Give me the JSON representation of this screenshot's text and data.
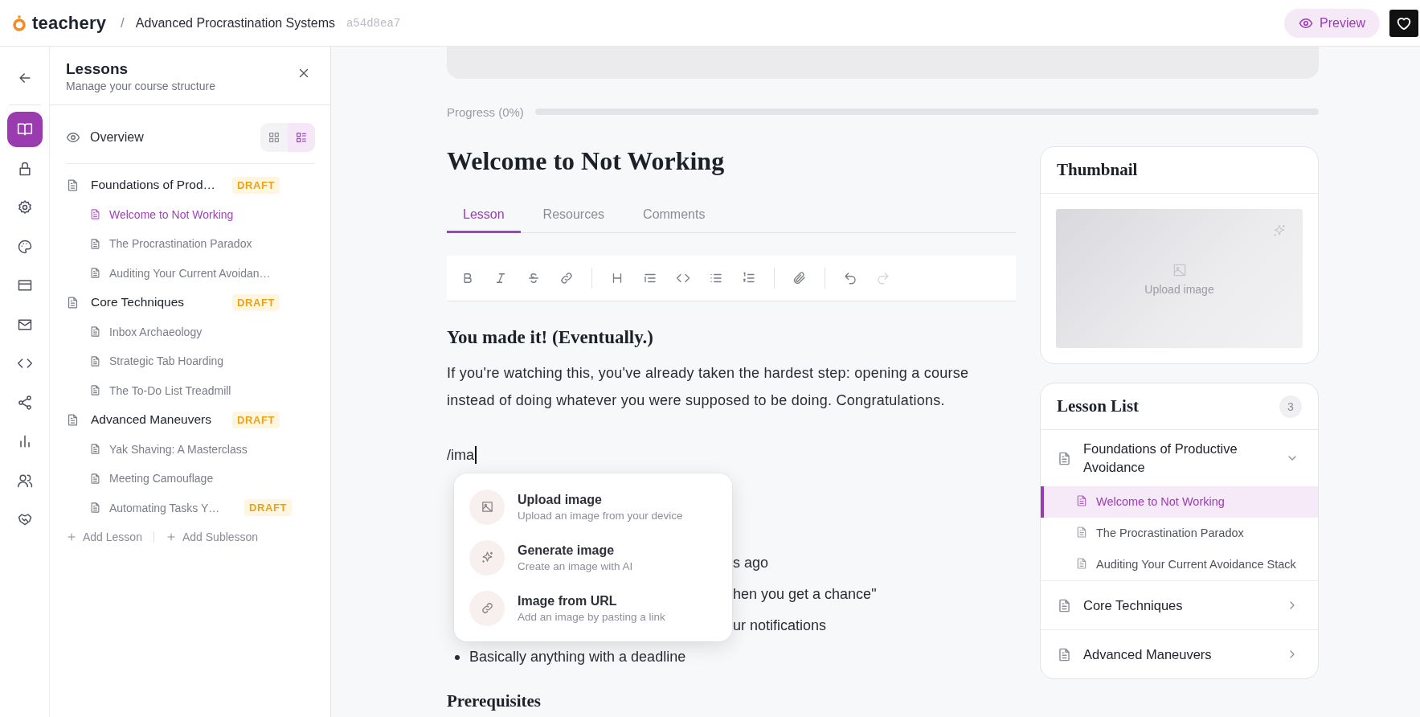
{
  "header": {
    "logo_text": "teachery",
    "separator": "/",
    "course_title": "Advanced Procrastination Systems",
    "course_id": "a54d8ea7",
    "preview_button": "Preview"
  },
  "rail": {
    "items": [
      {
        "selected": true
      },
      {
        "selected": false
      },
      {
        "selected": false
      },
      {
        "selected": false
      },
      {
        "selected": false
      },
      {
        "selected": false
      },
      {
        "selected": false
      },
      {
        "selected": false
      },
      {
        "selected": false
      },
      {
        "selected": false
      },
      {
        "selected": false
      }
    ]
  },
  "lessons_panel": {
    "title": "Lessons",
    "subtitle": "Manage your course structure",
    "overview": "Overview",
    "view_toggle": [
      {
        "selected": false
      },
      {
        "selected": true
      }
    ],
    "tree": [
      {
        "label": "Foundations of Prod…",
        "badge": "DRAFT",
        "selected": false,
        "children": [
          {
            "label": "Welcome to Not Working",
            "selected": true
          },
          {
            "label": "The Procrastination Paradox",
            "selected": false
          },
          {
            "label": "Auditing Your Current Avoidan…",
            "selected": false
          }
        ]
      },
      {
        "label": "Core Techniques",
        "badge": "DRAFT",
        "selected": false,
        "children": [
          {
            "label": "Inbox Archaeology",
            "selected": false
          },
          {
            "label": "Strategic Tab Hoarding",
            "selected": false
          },
          {
            "label": "The To-Do List Treadmill",
            "selected": false
          }
        ]
      },
      {
        "label": "Advanced Maneuvers",
        "badge": "DRAFT",
        "selected": false,
        "children": [
          {
            "label": "Yak Shaving: A Masterclass",
            "selected": false
          },
          {
            "label": "Meeting Camouflage",
            "selected": false
          },
          {
            "label": "Automating Tasks Y…",
            "badge": "DRAFT",
            "selected": false
          }
        ]
      }
    ],
    "add_lesson": "Add Lesson",
    "add_sublesson": "Add Sublesson"
  },
  "editor": {
    "progress_label": "Progress (0%)",
    "progress": {
      "level": 0
    },
    "title": "Welcome to Not Working",
    "tabs": [
      {
        "label": "Lesson",
        "selected": true
      },
      {
        "label": "Resources",
        "selected": false
      },
      {
        "label": "Comments",
        "selected": false
      }
    ],
    "toolbar": [
      [
        {
          "disabled": false
        },
        {
          "disabled": false
        },
        {
          "disabled": false
        },
        {
          "disabled": false
        }
      ],
      [
        {
          "disabled": false
        },
        {
          "disabled": false
        },
        {
          "disabled": false
        },
        {
          "disabled": false
        },
        {
          "disabled": false
        }
      ],
      [
        {
          "disabled": false
        }
      ],
      [
        {
          "disabled": false
        },
        {
          "disabled": true
        }
      ]
    ],
    "heading": "You made it! (Eventually.)",
    "paragraph": "If you're watching this, you've already taken the hardest step: opening a course instead of doing whatever you were supposed to be doing. Congratulations.",
    "slash_command": "/ima",
    "slash_menu": [
      {
        "title": "Upload image",
        "description": "Upload an image from your device"
      },
      {
        "title": "Generate image",
        "description": "Create an image with AI"
      },
      {
        "title": "Image from URL",
        "description": "Add an image by pasting a link"
      }
    ],
    "list": [
      {
        "kind": "covered",
        "text": "s ago"
      },
      {
        "kind": "covered",
        "text": "hen you get a chance\""
      },
      {
        "kind": "covered",
        "text": "ur notifications"
      },
      {
        "kind": "bullet",
        "text": "Basically anything with a deadline"
      }
    ],
    "next_heading": "Prerequisites"
  },
  "thumbnail": {
    "title": "Thumbnail",
    "upload_label": "Upload image"
  },
  "lesson_list": {
    "title": "Lesson List",
    "count": "3",
    "sections": [
      {
        "label": "Foundations of Productive Avoidance",
        "expanded": true,
        "children": [
          {
            "label": "Welcome to Not Working",
            "selected": true
          },
          {
            "label": "The Procrastination Paradox",
            "selected": false
          },
          {
            "label": "Auditing Your Current Avoidance Stack",
            "selected": false
          }
        ]
      },
      {
        "label": "Core Techniques",
        "expanded": false
      },
      {
        "label": "Advanced Maneuvers",
        "expanded": false
      }
    ]
  }
}
